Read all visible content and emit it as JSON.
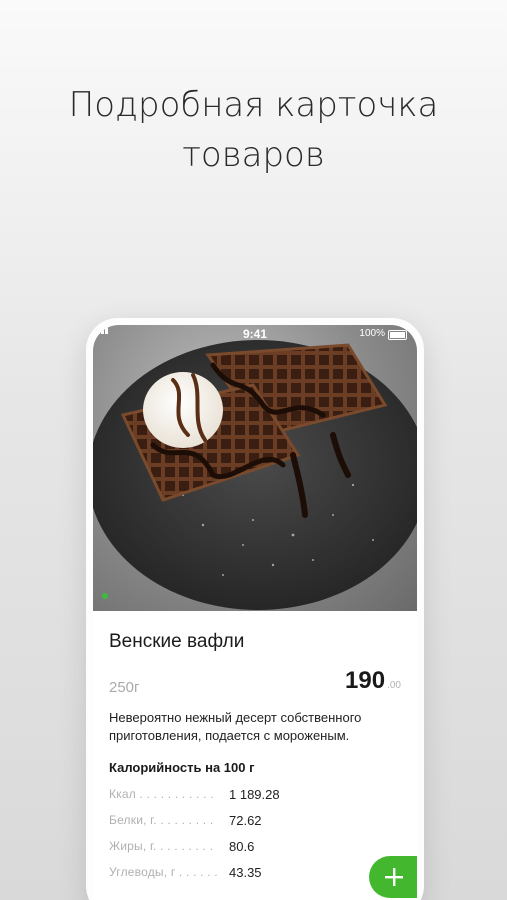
{
  "headline": {
    "line1": "Подробная карточка",
    "line2": "товаров"
  },
  "status_bar": {
    "time": "9:41",
    "battery": "100%"
  },
  "product": {
    "title": "Венские вафли",
    "weight": "250г",
    "price": "190",
    "price_cents": ".00",
    "description": "Невероятно нежный десерт собственного приготовления, подается с мороженым.",
    "calories_title": "Калорийность на 100 г",
    "nutrients": [
      {
        "label": "Ккал . . . . . . . . . . .",
        "value": "1 189.28"
      },
      {
        "label": "Белки, г. . . . . . . . .",
        "value": "72.62"
      },
      {
        "label": "Жиры, г. . . . . . . . .",
        "value": "80.6"
      },
      {
        "label": "Углеводы, г . . . . . .",
        "value": "43.35"
      }
    ]
  },
  "icons": {
    "add": "plus-icon",
    "signal": "signal-icon",
    "battery": "battery-icon"
  },
  "colors": {
    "accent": "#43b82f",
    "muted": "#aaaaaa",
    "text": "#1b1b1b"
  }
}
